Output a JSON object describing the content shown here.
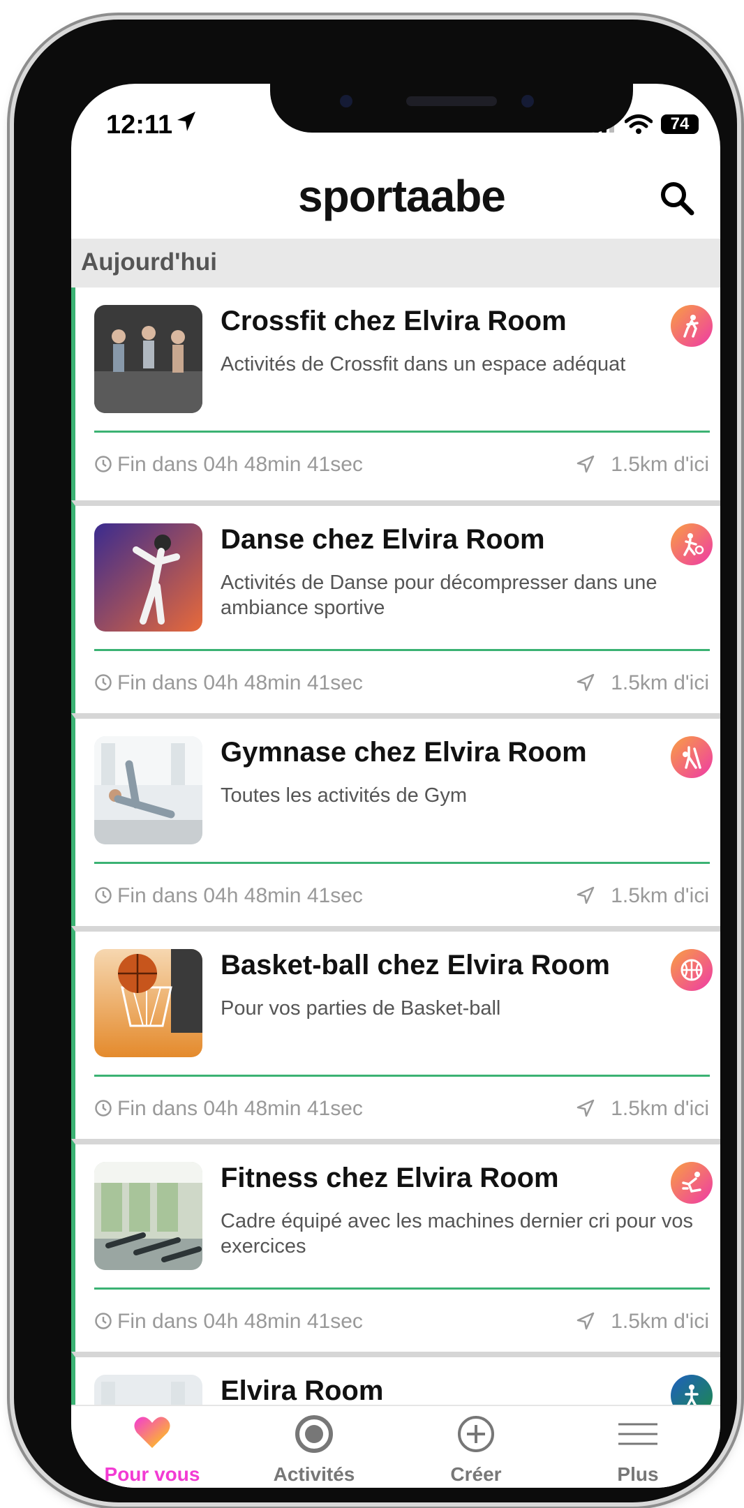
{
  "status_bar": {
    "time": "12:11",
    "battery": "74"
  },
  "header": {
    "logo": "sportaabe"
  },
  "section": {
    "title": "Aujourd'hui"
  },
  "cards": [
    {
      "title": "Crossfit chez Elvira Room",
      "description": "Activités de Crossfit dans un espace adéquat",
      "time_left": "Fin dans 04h 48min 41sec",
      "distance": "1.5km d'ici",
      "icon": "crossfit-icon"
    },
    {
      "title": "Danse chez Elvira Room",
      "description": "Activités de Danse pour décompresser dans une ambiance sportive",
      "time_left": "Fin dans 04h 48min 41sec",
      "distance": "1.5km d'ici",
      "icon": "dance-icon"
    },
    {
      "title": "Gymnase chez Elvira Room",
      "description": "Toutes les activités de Gym",
      "time_left": "Fin dans 04h 48min 41sec",
      "distance": "1.5km d'ici",
      "icon": "gym-icon"
    },
    {
      "title": "Basket-ball chez Elvira Room",
      "description": "Pour vos parties de Basket-ball",
      "time_left": "Fin dans 04h 48min 41sec",
      "distance": "1.5km d'ici",
      "icon": "basketball-icon"
    },
    {
      "title": "Fitness chez Elvira Room",
      "description": "Cadre équipé avec les machines dernier cri pour vos exercices",
      "time_left": "Fin dans 04h 48min 41sec",
      "distance": "1.5km d'ici",
      "icon": "fitness-icon"
    },
    {
      "title": "Elvira Room",
      "description": "",
      "time_left": "",
      "distance": "",
      "icon": "person-icon"
    }
  ],
  "tabbar": {
    "tabs": [
      {
        "label": "Pour vous",
        "icon": "heart-icon",
        "active": true
      },
      {
        "label": "Activités",
        "icon": "target-icon",
        "active": false
      },
      {
        "label": "Créer",
        "icon": "plus-circle-icon",
        "active": false
      },
      {
        "label": "Plus",
        "icon": "menu-icon",
        "active": false
      }
    ]
  },
  "colors": {
    "accent_green": "#3bb273",
    "active_pink": "#f23bd3",
    "badge_start": "#f8a042",
    "badge_end": "#ee3aa6"
  }
}
